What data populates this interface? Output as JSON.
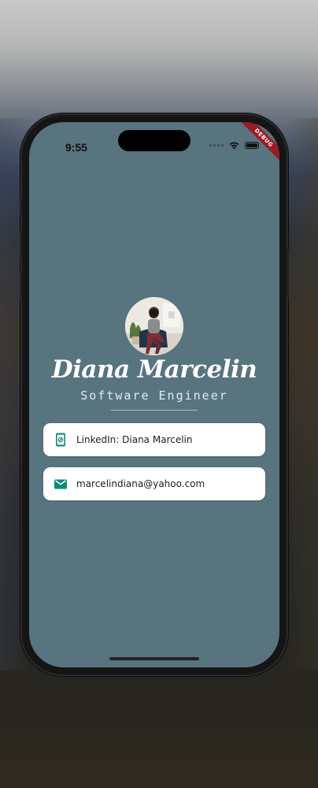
{
  "status_bar": {
    "time": "9:55"
  },
  "debug_banner": "DEBUG",
  "profile": {
    "name": "Diana Marcelin",
    "title": "Software Engineer"
  },
  "contacts": [
    {
      "icon": "phone-link-icon",
      "label": "LinkedIn: Diana Marcelin"
    },
    {
      "icon": "email-icon",
      "label": "marcelindiana@yahoo.com"
    }
  ],
  "colors": {
    "screen_background": "#57747f",
    "icon_accent": "#0f8a7a",
    "debug_ribbon": "#9b1b22"
  }
}
